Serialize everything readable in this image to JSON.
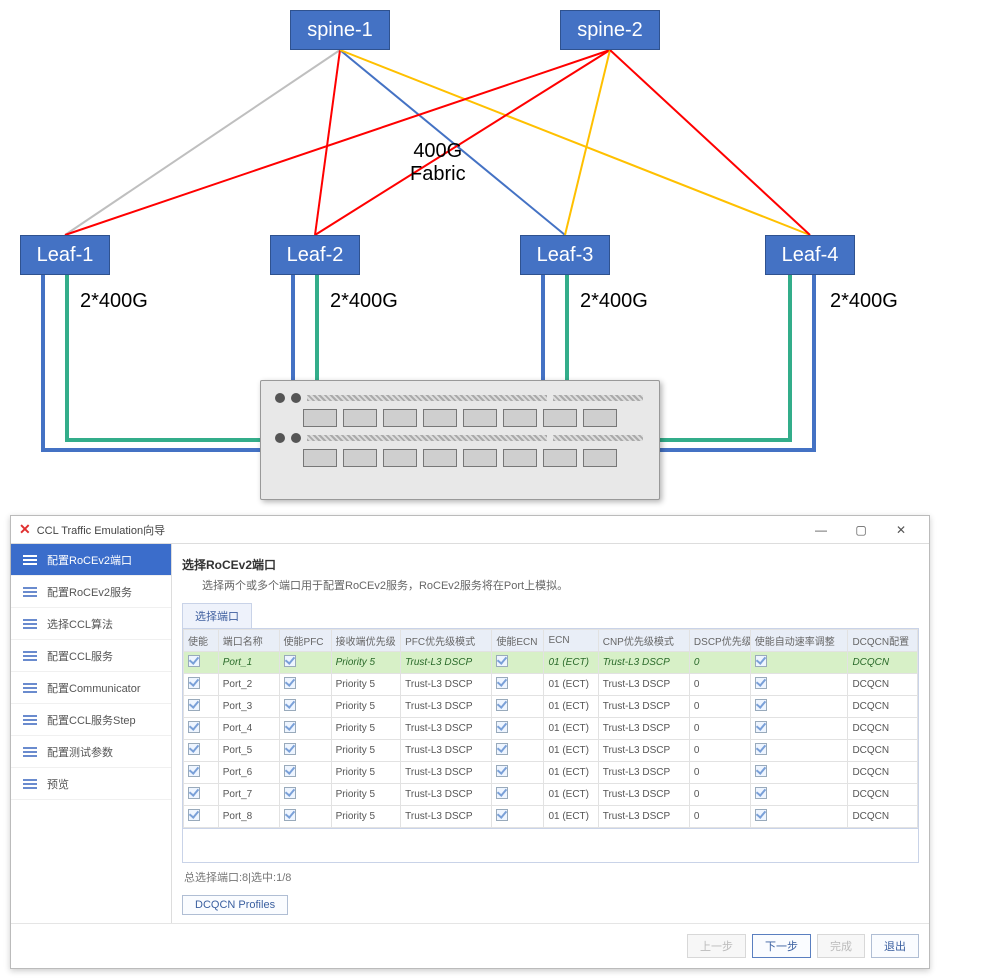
{
  "topology": {
    "spines": [
      "spine-1",
      "spine-2"
    ],
    "leaves": [
      "Leaf-1",
      "Leaf-2",
      "Leaf-3",
      "Leaf-4"
    ],
    "fabric_label": "400G\nFabric",
    "link_labels": [
      "2*400G",
      "2*400G",
      "2*400G",
      "2*400G"
    ]
  },
  "window": {
    "title": "CCL Traffic Emulation向导",
    "sidebar": [
      "配置RoCEv2端口",
      "配置RoCEv2服务",
      "选择CCL算法",
      "配置CCL服务",
      "配置Communicator",
      "配置CCL服务Step",
      "配置测试参数",
      "预览"
    ],
    "active_sidebar_index": 0,
    "panel_title": "选择RoCEv2端口",
    "panel_subtitle": "选择两个或多个端口用于配置RoCEv2服务，RoCEv2服务将在Port上模拟。",
    "tab_label": "选择端口",
    "columns": [
      "使能",
      "端口名称",
      "使能PFC",
      "接收端优先级",
      "PFC优先级模式",
      "使能ECN",
      "ECN",
      "CNP优先级模式",
      "DSCP优先级",
      "使能自动速率调整",
      "DCQCN配置"
    ],
    "rows": [
      {
        "name": "Port_1",
        "rxprio": "Priority 5",
        "pfcmode": "Trust-L3 DSCP",
        "ecn": "01 (ECT)",
        "cnpmode": "Trust-L3 DSCP",
        "dscp": "0",
        "dcqcn": "DCQCN",
        "selected": true
      },
      {
        "name": "Port_2",
        "rxprio": "Priority 5",
        "pfcmode": "Trust-L3 DSCP",
        "ecn": "01 (ECT)",
        "cnpmode": "Trust-L3 DSCP",
        "dscp": "0",
        "dcqcn": "DCQCN"
      },
      {
        "name": "Port_3",
        "rxprio": "Priority 5",
        "pfcmode": "Trust-L3 DSCP",
        "ecn": "01 (ECT)",
        "cnpmode": "Trust-L3 DSCP",
        "dscp": "0",
        "dcqcn": "DCQCN"
      },
      {
        "name": "Port_4",
        "rxprio": "Priority 5",
        "pfcmode": "Trust-L3 DSCP",
        "ecn": "01 (ECT)",
        "cnpmode": "Trust-L3 DSCP",
        "dscp": "0",
        "dcqcn": "DCQCN"
      },
      {
        "name": "Port_5",
        "rxprio": "Priority 5",
        "pfcmode": "Trust-L3 DSCP",
        "ecn": "01 (ECT)",
        "cnpmode": "Trust-L3 DSCP",
        "dscp": "0",
        "dcqcn": "DCQCN"
      },
      {
        "name": "Port_6",
        "rxprio": "Priority 5",
        "pfcmode": "Trust-L3 DSCP",
        "ecn": "01 (ECT)",
        "cnpmode": "Trust-L3 DSCP",
        "dscp": "0",
        "dcqcn": "DCQCN"
      },
      {
        "name": "Port_7",
        "rxprio": "Priority 5",
        "pfcmode": "Trust-L3 DSCP",
        "ecn": "01 (ECT)",
        "cnpmode": "Trust-L3 DSCP",
        "dscp": "0",
        "dcqcn": "DCQCN"
      },
      {
        "name": "Port_8",
        "rxprio": "Priority 5",
        "pfcmode": "Trust-L3 DSCP",
        "ecn": "01 (ECT)",
        "cnpmode": "Trust-L3 DSCP",
        "dscp": "0",
        "dcqcn": "DCQCN"
      }
    ],
    "footer_info": "总选择端口:8|选中:1/8",
    "profiles_btn": "DCQCN Profiles",
    "buttons": {
      "prev": "上一步",
      "next": "下一步",
      "finish": "完成",
      "exit": "退出"
    }
  }
}
